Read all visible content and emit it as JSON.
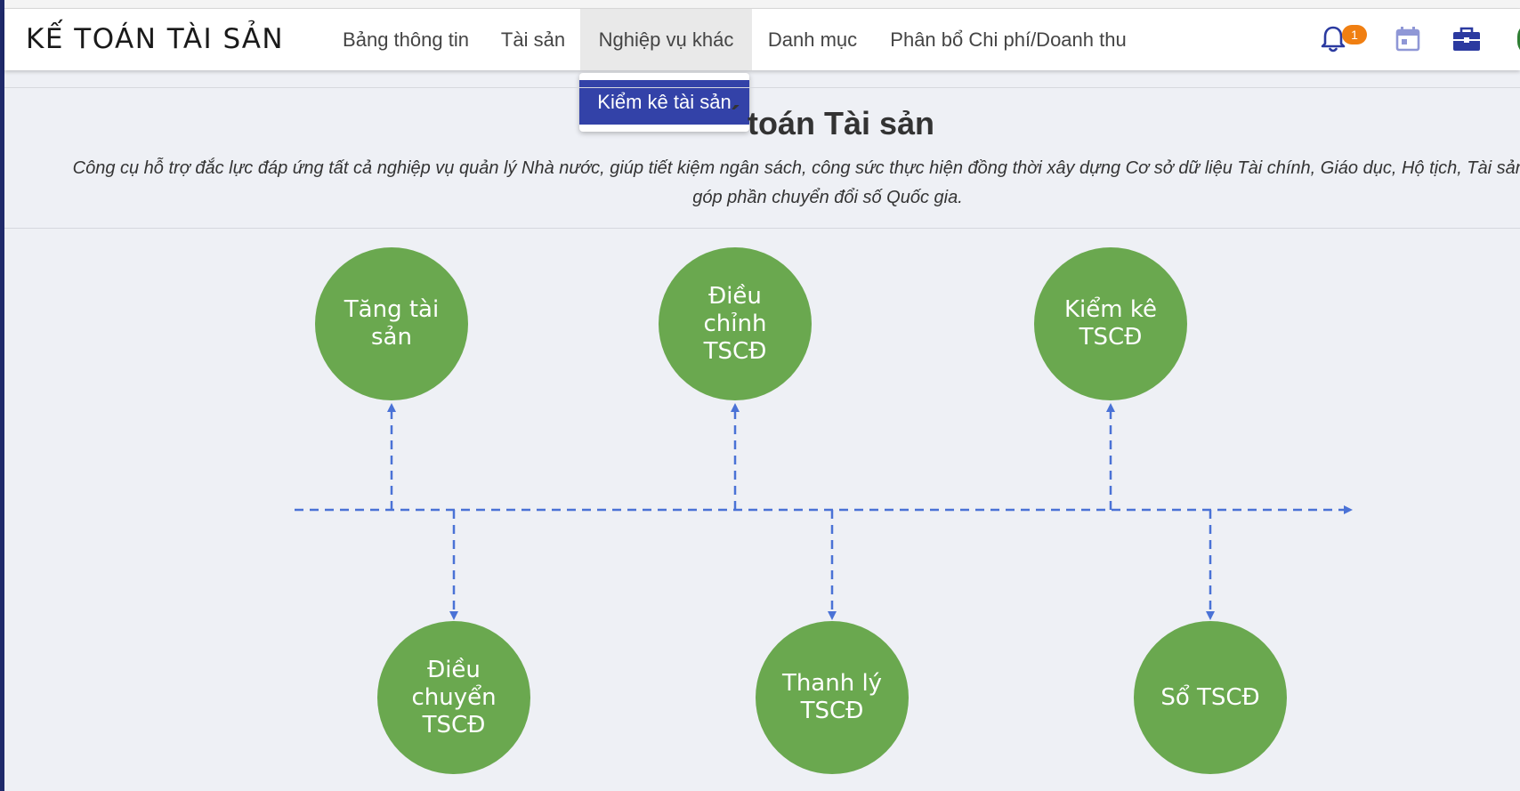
{
  "app": {
    "brand": "KẾ TOÁN TÀI SẢN"
  },
  "nav": {
    "items": [
      "Bảng thông tin",
      "Tài sản",
      "Nghiệp vụ khác",
      "Danh mục",
      "Phân bổ Chi phí/Doanh thu"
    ],
    "active_index": 2,
    "notification_count": "1",
    "icons": [
      "bell-icon",
      "calendar-icon",
      "briefcase-icon"
    ]
  },
  "dropdown": {
    "items": [
      "Kiểm kê tài sản"
    ]
  },
  "page": {
    "title_visible": "́ toán Tài sản",
    "description_line1": "Công cụ hỗ trợ đắc lực đáp ứng tất cả nghiệp vụ quản lý Nhà nước, giúp tiết kiệm ngân sách, công sức thực hiện đồng thời xây dựng Cơ sở dữ liệu Tài chính, Giáo dục, Hộ tịch, Tài sản, Cán b",
    "description_line2": "góp phần chuyển đổi số Quốc gia."
  },
  "diagram": {
    "top_nodes": [
      "Tăng tài\nsản",
      "Điều\nchỉnh\nTSCĐ",
      "Kiểm kê\nTSCĐ"
    ],
    "bottom_nodes": [
      "Điều\nchuyển\nTSCĐ",
      "Thanh lý\nTSCĐ",
      "Sổ TSCĐ"
    ],
    "node_color": "#6aa84f",
    "connector_color": "#4a72d6"
  }
}
